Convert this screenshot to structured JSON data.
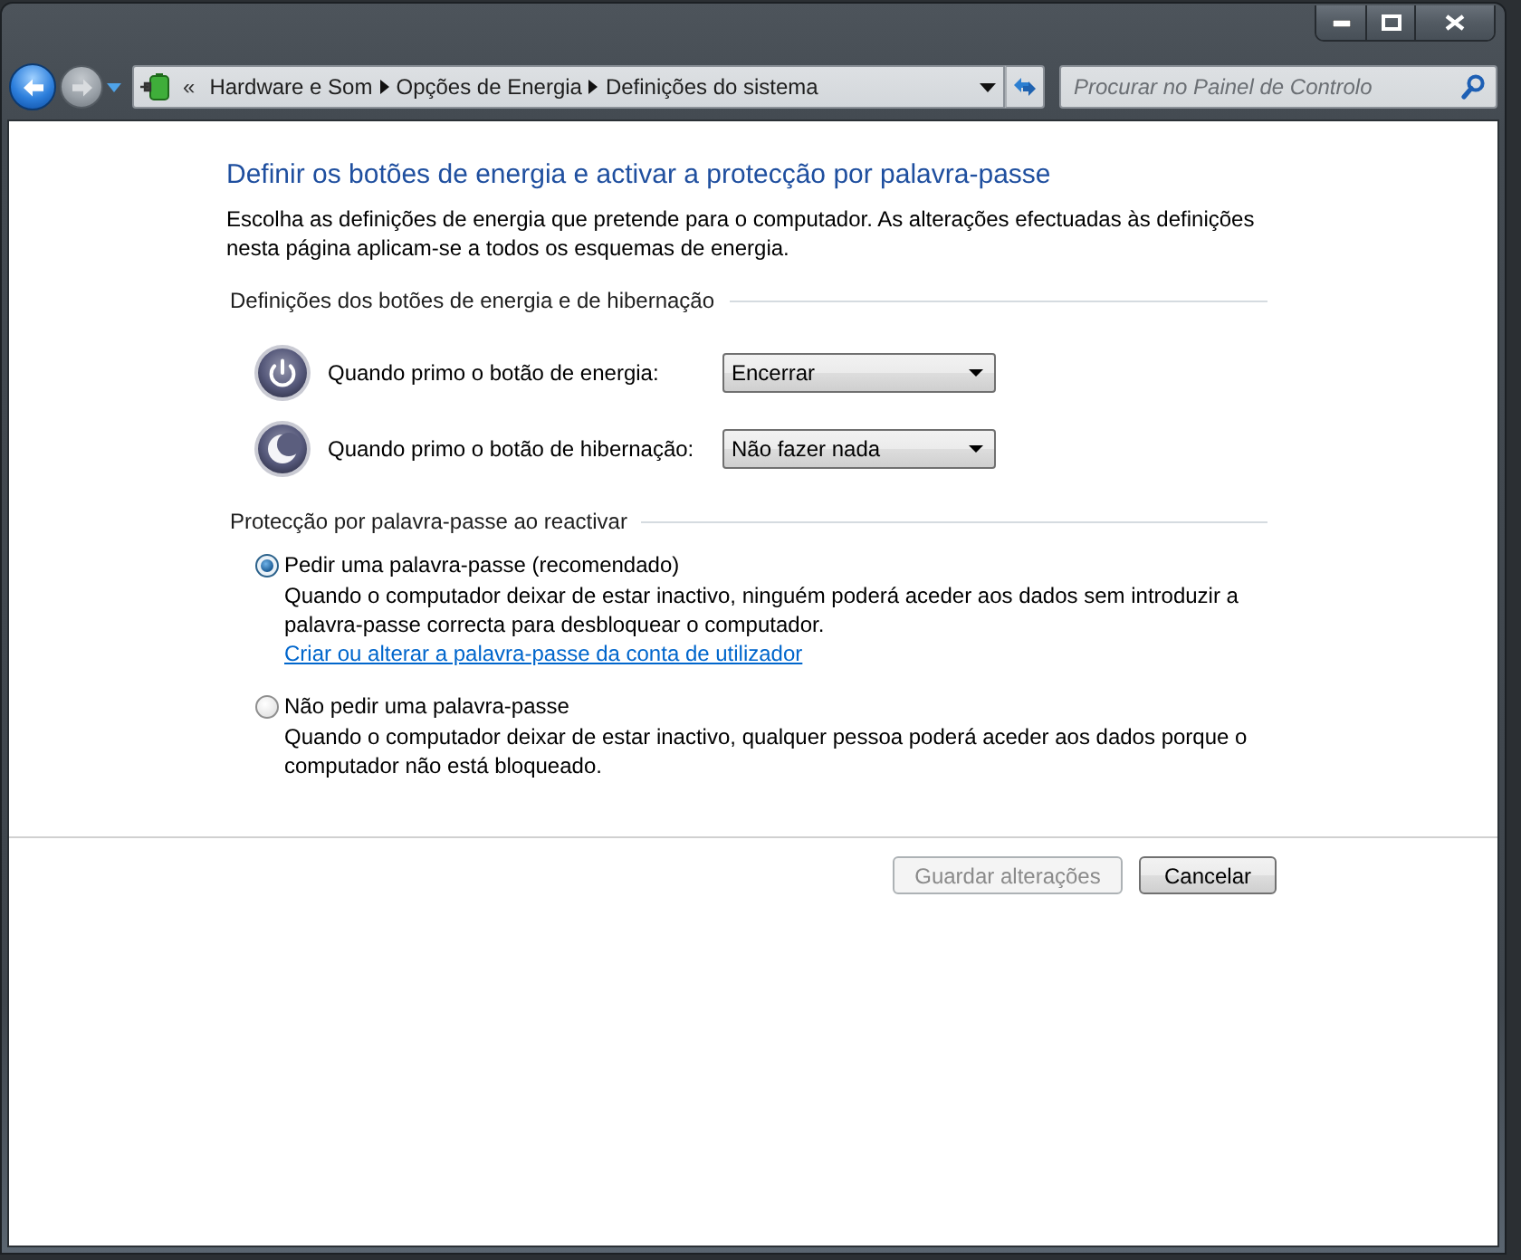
{
  "navigation": {
    "buttons": [
      {
        "kind": "back",
        "disabled": false
      },
      {
        "kind": "forward",
        "disabled": true
      }
    ],
    "overflow": "«",
    "breadcrumbs": [
      "Hardware e Som",
      "Opções de Energia",
      "Definições do sistema"
    ]
  },
  "search": {
    "placeholder": "Procurar no Painel de Controlo"
  },
  "page": {
    "title": "Definir os botões de energia e activar a protecção por palavra-passe",
    "description": "Escolha as definições de energia que pretende para o computador. As alterações efectuadas às definições nesta página aplicam-se a todos os esquemas de energia.",
    "sections": [
      {
        "kind": "dropdowns",
        "heading": "Definições dos botões de energia e de hibernação",
        "rows": [
          {
            "kind": "power",
            "label": "Quando primo o botão de energia:",
            "value": "Encerrar"
          },
          {
            "kind": "sleep",
            "label": "Quando primo o botão de hibernação:",
            "value": "Não fazer nada"
          }
        ]
      },
      {
        "kind": "radios",
        "heading": "Protecção por palavra-passe ao reactivar",
        "options": [
          {
            "label": "Pedir uma palavra-passe (recomendado)",
            "selected": true,
            "description": "Quando o computador deixar de estar inactivo, ninguém poderá aceder aos dados sem introduzir a palavra-passe correcta para desbloquear o computador.",
            "link": "Criar ou alterar a palavra-passe da conta de utilizador"
          },
          {
            "label": "Não pedir uma palavra-passe",
            "selected": false,
            "description": "Quando o computador deixar de estar inactivo, qualquer pessoa poderá aceder aos dados porque o computador não está bloqueado."
          }
        ]
      }
    ]
  },
  "buttons": [
    {
      "label": "Guardar alterações",
      "disabled": true
    },
    {
      "label": "Cancelar",
      "disabled": false
    }
  ]
}
